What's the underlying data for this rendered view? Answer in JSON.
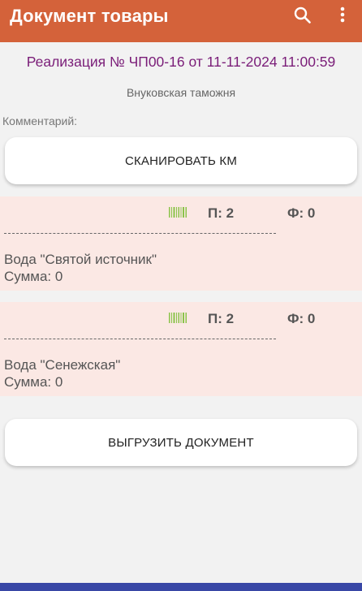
{
  "appbar": {
    "title": "Документ товары",
    "search_icon": "search-icon",
    "more_icon": "more-vert-icon",
    "bg_color": "#d4623a"
  },
  "document": {
    "title": "Реализация № ЧП00-16 от 11-11-2024 11:00:59",
    "warehouse": "Внуковская таможня",
    "comment_label": "Комментарий:"
  },
  "buttons": {
    "scan_label": "СКАНИРОВАТЬ КМ",
    "upload_label": "ВЫГРУЗИТЬ ДОКУМЕНТ"
  },
  "items": [
    {
      "planned": "П: 2",
      "fact": "Ф: 0",
      "name": "Вода \"Святой источник\"",
      "sum": "Сумма: 0"
    },
    {
      "planned": "П: 2",
      "fact": "Ф: 0",
      "name": "Вода \"Сенежская\"",
      "sum": "Сумма: 0"
    }
  ],
  "colors": {
    "doc_title": "#7a1d78",
    "card_bg": "#fbe8e4",
    "barcode_green": "#8bc34a",
    "bottom_bar": "#3947a6"
  }
}
